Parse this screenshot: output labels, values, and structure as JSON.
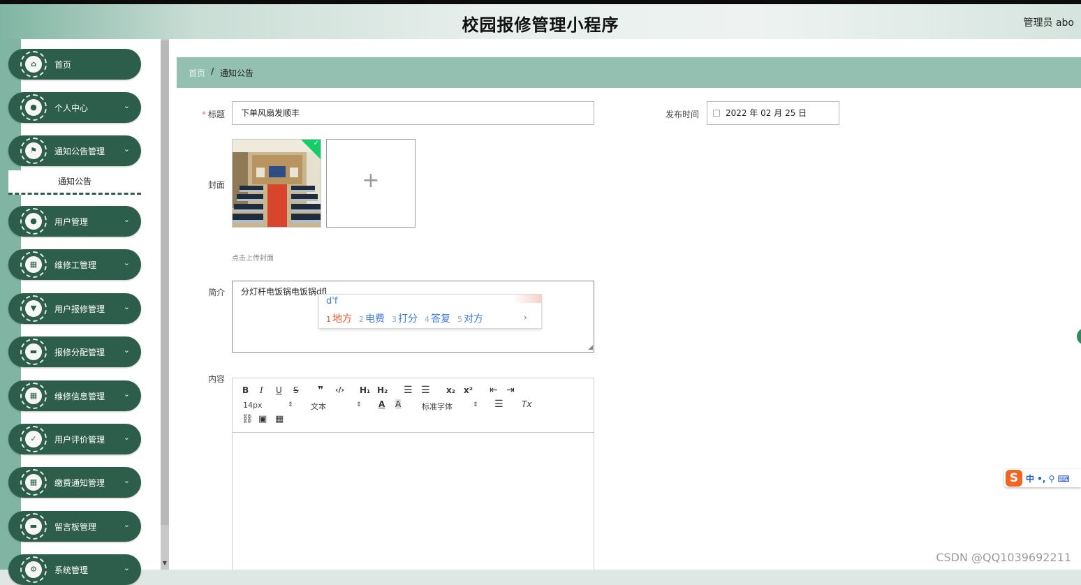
{
  "app": {
    "title": "校园报修管理小程序",
    "user": "管理员 abo"
  },
  "sidebar": {
    "items": [
      {
        "label": "首页",
        "icon": "home-icon",
        "glyph": "⌂",
        "has_arrow": false
      },
      {
        "label": "个人中心",
        "icon": "user-icon",
        "glyph": "●",
        "has_arrow": true
      },
      {
        "label": "通知公告管理",
        "icon": "flag-icon",
        "glyph": "⚑",
        "has_arrow": true
      },
      {
        "label": "用户管理",
        "icon": "user-icon",
        "glyph": "●",
        "has_arrow": true
      },
      {
        "label": "维修工管理",
        "icon": "grid-icon",
        "glyph": "▦",
        "has_arrow": true
      },
      {
        "label": "用户报修管理",
        "icon": "stamp-icon",
        "glyph": "▼",
        "has_arrow": true
      },
      {
        "label": "报修分配管理",
        "icon": "briefcase-icon",
        "glyph": "▬",
        "has_arrow": true
      },
      {
        "label": "维修信息管理",
        "icon": "grid-icon",
        "glyph": "▦",
        "has_arrow": true
      },
      {
        "label": "用户评价管理",
        "icon": "clipboard-check-icon",
        "glyph": "✓",
        "has_arrow": true
      },
      {
        "label": "缴费通知管理",
        "icon": "grid-icon",
        "glyph": "▦",
        "has_arrow": true
      },
      {
        "label": "留言板管理",
        "icon": "message-icon",
        "glyph": "▬",
        "has_arrow": true
      },
      {
        "label": "系统管理",
        "icon": "gear-icon",
        "glyph": "⚙",
        "has_arrow": true
      }
    ],
    "submenu": {
      "label": "通知公告"
    },
    "arrow_glyph": "⌄"
  },
  "breadcrumb": {
    "home": "首页",
    "separator": "/",
    "current": "通知公告"
  },
  "form": {
    "title_label": "标题",
    "title_value": "下单风扇发顺丰",
    "publish_time_label": "发布时间",
    "publish_time_value": "2022 年 02 月 25 日",
    "cover_label": "封面",
    "cover_hint": "点击上传封面",
    "summary_label": "简介",
    "summary_value": "分灯杆电饭锅电饭锅dfl",
    "content_label": "内容"
  },
  "ime": {
    "composition": "d'f",
    "candidates": [
      {
        "num": "1",
        "text": "地方"
      },
      {
        "num": "2",
        "text": "电费"
      },
      {
        "num": "3",
        "text": "打分"
      },
      {
        "num": "4",
        "text": "答复"
      },
      {
        "num": "5",
        "text": "对方"
      }
    ],
    "more": "›"
  },
  "editor": {
    "font_size": "14px",
    "header_select": "文本",
    "font_family": "标准字体"
  },
  "ime_toolbar": {
    "logo": "S",
    "text": "中 •, ⚲ ⌨"
  },
  "watermark": "CSDN @QQ1039692211"
}
